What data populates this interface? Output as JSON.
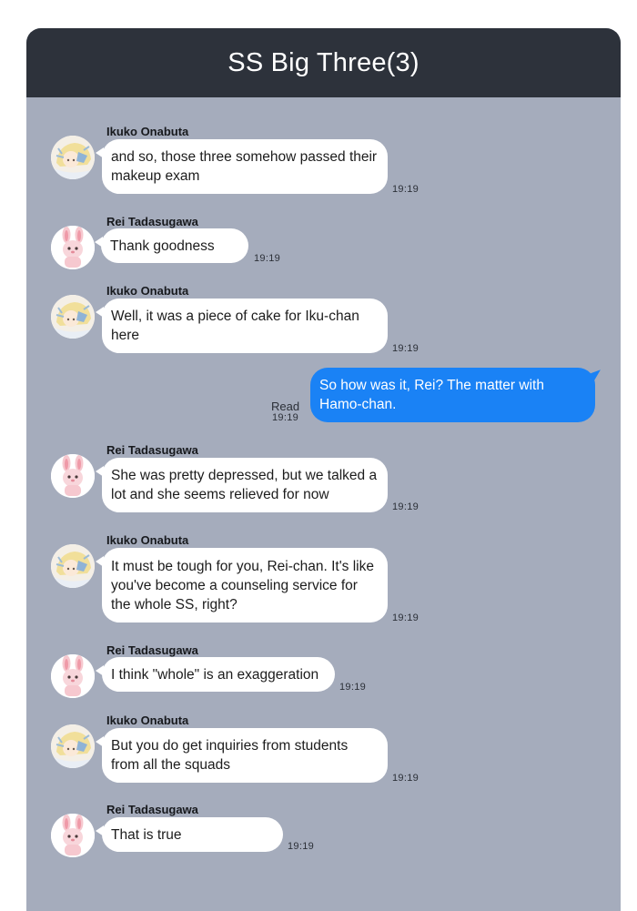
{
  "header": {
    "title": "SS Big Three(3)"
  },
  "read_receipt": {
    "label": "Read",
    "time": "19:19"
  },
  "messages": [
    {
      "sender": "Ikuko Onabuta",
      "text": "and so, those three somehow passed their makeup exam",
      "time": "19:19",
      "avatar": "ikuko-avatar"
    },
    {
      "sender": "Rei Tadasugawa",
      "text": "Thank goodness",
      "time": "19:19",
      "avatar": "rei-avatar"
    },
    {
      "sender": "Ikuko Onabuta",
      "text": "Well, it was a piece of cake for Iku-chan here",
      "time": "19:19",
      "avatar": "ikuko-avatar"
    },
    {
      "sender": "",
      "text": "So how was it, Rei? The matter with Hamo-chan.",
      "time": "19:19",
      "outgoing": true
    },
    {
      "sender": "Rei Tadasugawa",
      "text": "She was pretty depressed, but we talked a lot and she seems relieved for now",
      "time": "19:19",
      "avatar": "rei-avatar"
    },
    {
      "sender": "Ikuko Onabuta",
      "text": "It must be tough for you, Rei-chan. It's like you've become a counseling service for the whole SS, right?",
      "time": "19:19",
      "avatar": "ikuko-avatar"
    },
    {
      "sender": "Rei Tadasugawa",
      "text": "I think \"whole\" is an exaggeration",
      "time": "19:19",
      "avatar": "rei-avatar"
    },
    {
      "sender": "Ikuko Onabuta",
      "text": "But you do get inquiries from students from all the squads",
      "time": "19:19",
      "avatar": "ikuko-avatar"
    },
    {
      "sender": "Rei Tadasugawa",
      "text": "That is true",
      "time": "19:19",
      "avatar": "rei-avatar"
    }
  ],
  "colors": {
    "header_bg": "#2d323b",
    "chat_bg": "#a5acbc",
    "outgoing_bubble": "#1a82f5",
    "incoming_bubble": "#ffffff"
  }
}
